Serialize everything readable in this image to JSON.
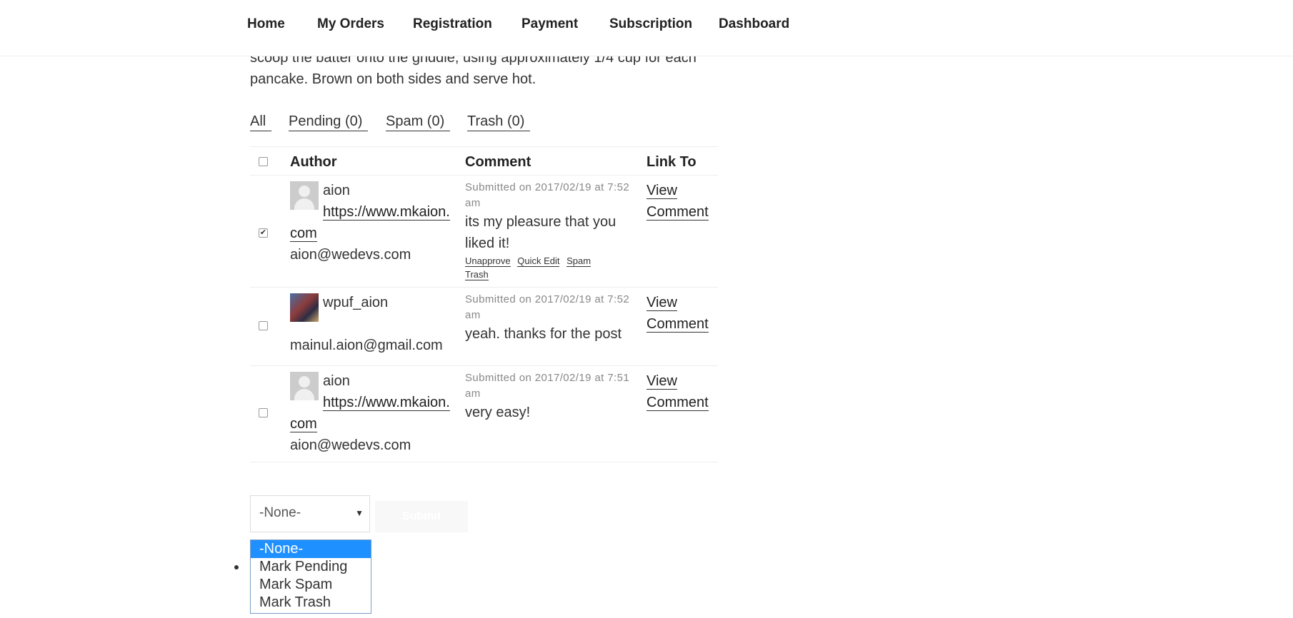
{
  "nav": {
    "items": [
      "Home",
      "My Orders",
      "Registration",
      "Payment",
      "Subscription",
      "Dashboard"
    ]
  },
  "intro": {
    "text": "scoop the batter onto the griddle, using approximately 1/4 cup for each pancake. Brown on both sides and serve hot."
  },
  "filters": [
    "All",
    "Pending (0)",
    "Spam (0)",
    "Trash (0)"
  ],
  "table": {
    "headers": {
      "author": "Author",
      "comment": "Comment",
      "link": "Link To"
    },
    "rows": [
      {
        "checked": true,
        "avatar": "default-avatar-icon",
        "author_name": "aion",
        "author_url": "https://www.mkaion.com",
        "author_email": "aion@wedevs.com",
        "submitted": "Submitted on 2017/02/19 at 7:52 am",
        "comment": "its my pleasure that you liked it!",
        "actions": [
          "Unapprove",
          "Quick Edit",
          "Spam",
          "Trash"
        ],
        "link": "View Comment"
      },
      {
        "checked": false,
        "avatar": "user-photo-avatar",
        "author_name": "wpuf_aion",
        "author_url": "",
        "author_email": "mainul.aion@gmail.com",
        "submitted": "Submitted on 2017/02/19 at 7:52 am",
        "comment": "yeah. thanks for the post",
        "actions": [],
        "link": "View Comment"
      },
      {
        "checked": false,
        "avatar": "default-avatar-icon",
        "author_name": "aion",
        "author_url": "https://www.mkaion.com",
        "author_email": "aion@wedevs.com",
        "submitted": "Submitted on 2017/02/19 at 7:51 am",
        "comment": "very easy!",
        "actions": [],
        "link": "View Comment"
      }
    ]
  },
  "bulk": {
    "selected": "-None-",
    "submit_label": "Submit",
    "options": [
      "-None-",
      "Mark Pending",
      "Mark Spam",
      "Mark Trash"
    ]
  },
  "colors": {
    "selected_option_bg": "#1e90ff",
    "text": "#333333"
  }
}
